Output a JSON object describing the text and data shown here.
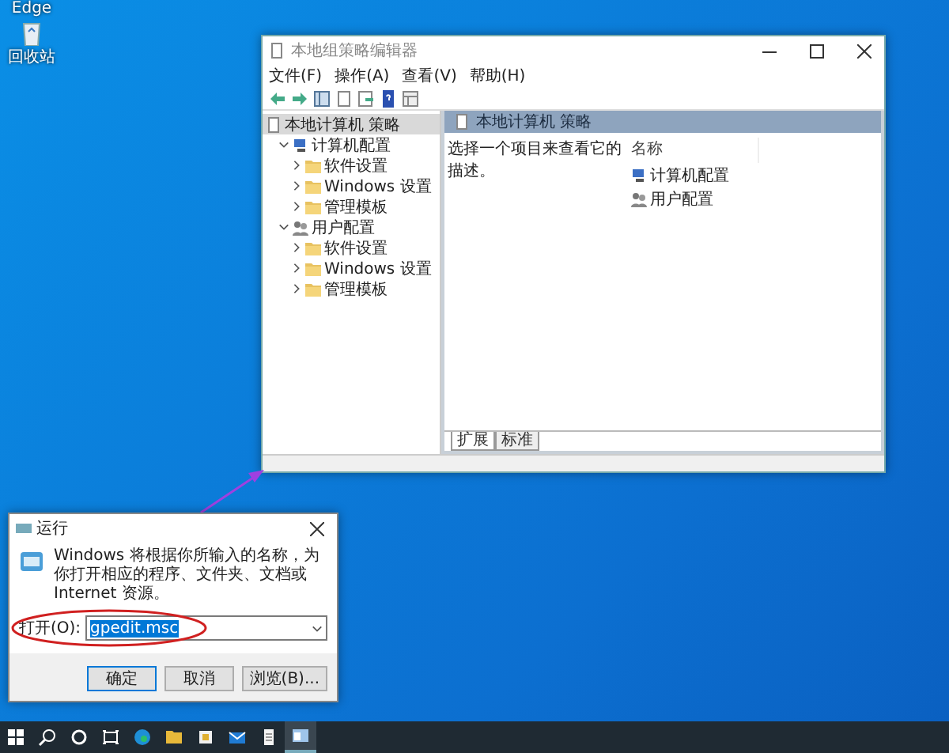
{
  "desktop_icons": [
    {
      "label": "Edge",
      "kind": "edge"
    },
    {
      "label": "回收站",
      "kind": "recycle"
    }
  ],
  "gpedit_window": {
    "title": "本地组策略编辑器",
    "menu": [
      "文件(F)",
      "操作(A)",
      "查看(V)",
      "帮助(H)"
    ],
    "tree": [
      {
        "label": "本地计算机 策略",
        "selected": true,
        "kind": "policy",
        "children": [
          {
            "label": "计算机配置",
            "kind": "computer",
            "expanded": true,
            "selected": false,
            "children": [
              {
                "label": "软件设置",
                "kind": "folder",
                "expanded": false,
                "selected": false
              },
              {
                "label": "Windows 设置",
                "kind": "folder",
                "expanded": false,
                "selected": false
              },
              {
                "label": "管理模板",
                "kind": "folder",
                "expanded": false,
                "selected": false
              }
            ]
          },
          {
            "label": "用户配置",
            "kind": "user",
            "expanded": true,
            "selected": false,
            "children": [
              {
                "label": "软件设置",
                "kind": "folder",
                "expanded": false,
                "selected": false
              },
              {
                "label": "Windows 设置",
                "kind": "folder",
                "expanded": false,
                "selected": false
              },
              {
                "label": "管理模板",
                "kind": "folder",
                "expanded": false,
                "selected": false
              }
            ]
          }
        ]
      }
    ],
    "header": "本地计算机 策略",
    "description": "选择一个项目来查看它的描述。",
    "list_column": "名称",
    "list_items": [
      {
        "label": "计算机配置",
        "kind": "computer"
      },
      {
        "label": "用户配置",
        "kind": "user"
      }
    ],
    "tabs": [
      {
        "label": "扩展",
        "selected": true
      },
      {
        "label": "标准",
        "selected": false
      }
    ]
  },
  "run_dialog": {
    "title": "运行",
    "message": "Windows 将根据你所输入的名称，为你打开相应的程序、文件夹、文档或 Internet 资源。",
    "field_label": "打开(O):",
    "field_value": "gpedit.msc",
    "buttons": [
      "确定",
      "取消",
      "浏览(B)..."
    ]
  },
  "taskbar": {
    "apps": [
      {
        "kind": "edge",
        "selected": false
      },
      {
        "kind": "explorer",
        "selected": false
      },
      {
        "kind": "store",
        "selected": false
      },
      {
        "kind": "mail",
        "selected": false
      },
      {
        "kind": "notepad",
        "selected": false
      },
      {
        "kind": "gpedit",
        "selected": true
      }
    ]
  }
}
